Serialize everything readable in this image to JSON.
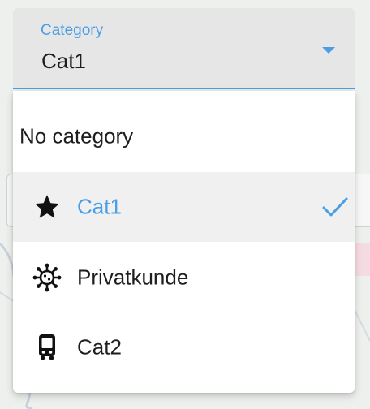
{
  "select": {
    "label": "Category",
    "value": "Cat1",
    "accent_color": "#4a9ee6"
  },
  "menu": {
    "items": [
      {
        "label": "No category",
        "icon": "none",
        "selected": false
      },
      {
        "label": "Cat1",
        "icon": "star-icon",
        "selected": true
      },
      {
        "label": "Privatkunde",
        "icon": "virus-icon",
        "selected": false
      },
      {
        "label": "Cat2",
        "icon": "bus-icon",
        "selected": false
      }
    ]
  }
}
